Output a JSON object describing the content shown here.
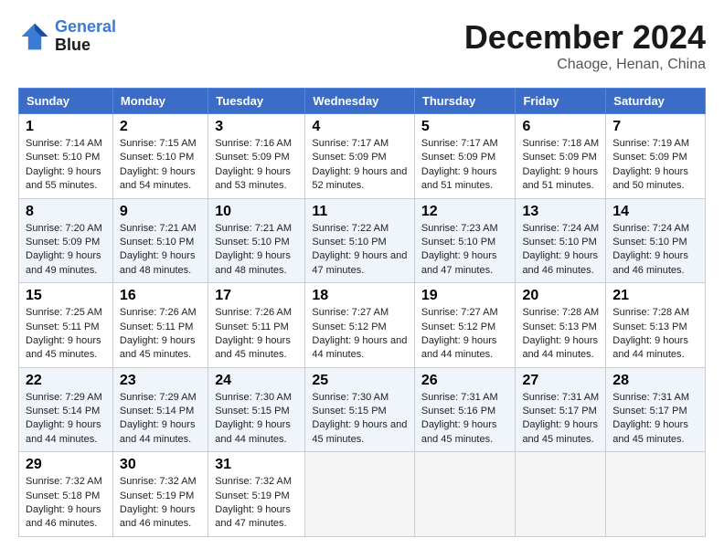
{
  "header": {
    "logo_line1": "General",
    "logo_line2": "Blue",
    "main_title": "December 2024",
    "subtitle": "Chaoge, Henan, China"
  },
  "days_of_week": [
    "Sunday",
    "Monday",
    "Tuesday",
    "Wednesday",
    "Thursday",
    "Friday",
    "Saturday"
  ],
  "weeks": [
    [
      {
        "day": 1,
        "sunrise": "7:14 AM",
        "sunset": "5:10 PM",
        "daylight": "9 hours and 55 minutes."
      },
      {
        "day": 2,
        "sunrise": "7:15 AM",
        "sunset": "5:10 PM",
        "daylight": "9 hours and 54 minutes."
      },
      {
        "day": 3,
        "sunrise": "7:16 AM",
        "sunset": "5:09 PM",
        "daylight": "9 hours and 53 minutes."
      },
      {
        "day": 4,
        "sunrise": "7:17 AM",
        "sunset": "5:09 PM",
        "daylight": "9 hours and 52 minutes."
      },
      {
        "day": 5,
        "sunrise": "7:17 AM",
        "sunset": "5:09 PM",
        "daylight": "9 hours and 51 minutes."
      },
      {
        "day": 6,
        "sunrise": "7:18 AM",
        "sunset": "5:09 PM",
        "daylight": "9 hours and 51 minutes."
      },
      {
        "day": 7,
        "sunrise": "7:19 AM",
        "sunset": "5:09 PM",
        "daylight": "9 hours and 50 minutes."
      }
    ],
    [
      {
        "day": 8,
        "sunrise": "7:20 AM",
        "sunset": "5:09 PM",
        "daylight": "9 hours and 49 minutes."
      },
      {
        "day": 9,
        "sunrise": "7:21 AM",
        "sunset": "5:10 PM",
        "daylight": "9 hours and 48 minutes."
      },
      {
        "day": 10,
        "sunrise": "7:21 AM",
        "sunset": "5:10 PM",
        "daylight": "9 hours and 48 minutes."
      },
      {
        "day": 11,
        "sunrise": "7:22 AM",
        "sunset": "5:10 PM",
        "daylight": "9 hours and 47 minutes."
      },
      {
        "day": 12,
        "sunrise": "7:23 AM",
        "sunset": "5:10 PM",
        "daylight": "9 hours and 47 minutes."
      },
      {
        "day": 13,
        "sunrise": "7:24 AM",
        "sunset": "5:10 PM",
        "daylight": "9 hours and 46 minutes."
      },
      {
        "day": 14,
        "sunrise": "7:24 AM",
        "sunset": "5:10 PM",
        "daylight": "9 hours and 46 minutes."
      }
    ],
    [
      {
        "day": 15,
        "sunrise": "7:25 AM",
        "sunset": "5:11 PM",
        "daylight": "9 hours and 45 minutes."
      },
      {
        "day": 16,
        "sunrise": "7:26 AM",
        "sunset": "5:11 PM",
        "daylight": "9 hours and 45 minutes."
      },
      {
        "day": 17,
        "sunrise": "7:26 AM",
        "sunset": "5:11 PM",
        "daylight": "9 hours and 45 minutes."
      },
      {
        "day": 18,
        "sunrise": "7:27 AM",
        "sunset": "5:12 PM",
        "daylight": "9 hours and 44 minutes."
      },
      {
        "day": 19,
        "sunrise": "7:27 AM",
        "sunset": "5:12 PM",
        "daylight": "9 hours and 44 minutes."
      },
      {
        "day": 20,
        "sunrise": "7:28 AM",
        "sunset": "5:13 PM",
        "daylight": "9 hours and 44 minutes."
      },
      {
        "day": 21,
        "sunrise": "7:28 AM",
        "sunset": "5:13 PM",
        "daylight": "9 hours and 44 minutes."
      }
    ],
    [
      {
        "day": 22,
        "sunrise": "7:29 AM",
        "sunset": "5:14 PM",
        "daylight": "9 hours and 44 minutes."
      },
      {
        "day": 23,
        "sunrise": "7:29 AM",
        "sunset": "5:14 PM",
        "daylight": "9 hours and 44 minutes."
      },
      {
        "day": 24,
        "sunrise": "7:30 AM",
        "sunset": "5:15 PM",
        "daylight": "9 hours and 44 minutes."
      },
      {
        "day": 25,
        "sunrise": "7:30 AM",
        "sunset": "5:15 PM",
        "daylight": "9 hours and 45 minutes."
      },
      {
        "day": 26,
        "sunrise": "7:31 AM",
        "sunset": "5:16 PM",
        "daylight": "9 hours and 45 minutes."
      },
      {
        "day": 27,
        "sunrise": "7:31 AM",
        "sunset": "5:17 PM",
        "daylight": "9 hours and 45 minutes."
      },
      {
        "day": 28,
        "sunrise": "7:31 AM",
        "sunset": "5:17 PM",
        "daylight": "9 hours and 45 minutes."
      }
    ],
    [
      {
        "day": 29,
        "sunrise": "7:32 AM",
        "sunset": "5:18 PM",
        "daylight": "9 hours and 46 minutes."
      },
      {
        "day": 30,
        "sunrise": "7:32 AM",
        "sunset": "5:19 PM",
        "daylight": "9 hours and 46 minutes."
      },
      {
        "day": 31,
        "sunrise": "7:32 AM",
        "sunset": "5:19 PM",
        "daylight": "9 hours and 47 minutes."
      },
      null,
      null,
      null,
      null
    ]
  ]
}
